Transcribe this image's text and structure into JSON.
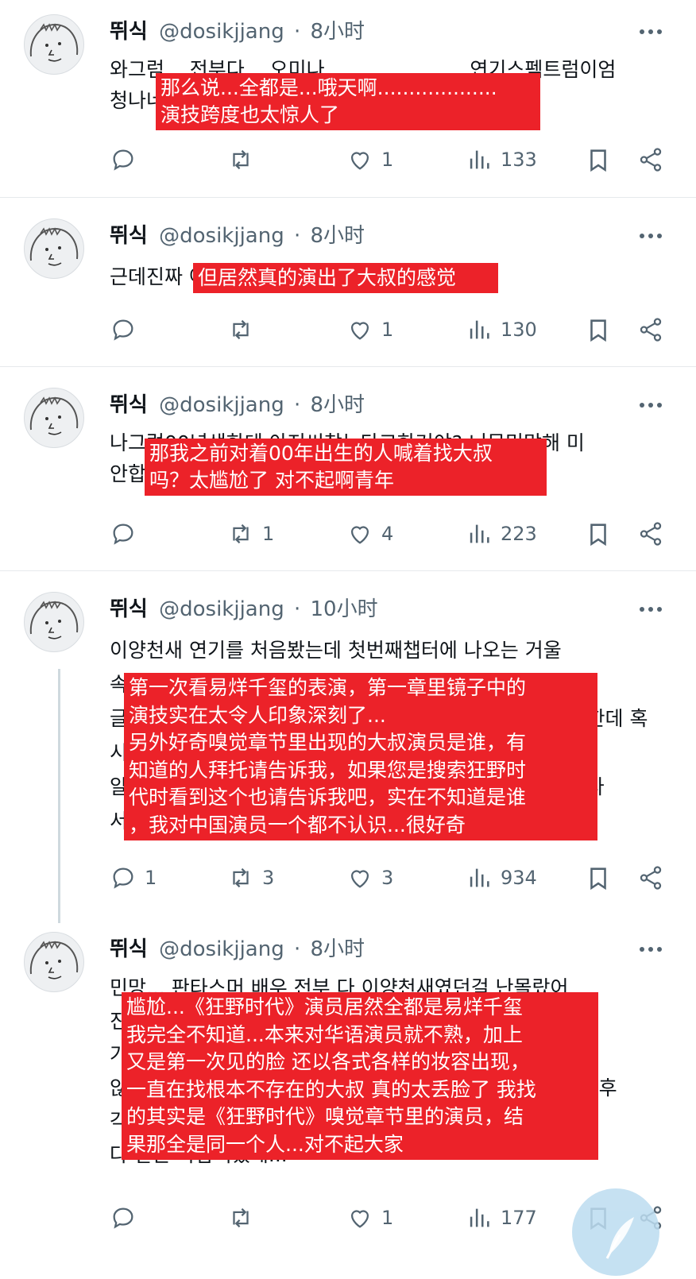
{
  "tweets": [
    {
      "name": "뛰식",
      "handle": "@dosikjjang",
      "time": "8小时",
      "text": "와그럼... 전부다... 오미나...................... 연기스펙트럼이엄\n청나네",
      "translation": "那么说...全都是...哦天啊...................\n演技跨度也太惊人了",
      "replies": "",
      "reposts": "",
      "likes": "1",
      "views": "133"
    },
    {
      "name": "뛰식",
      "handle": "@dosikjjang",
      "time": "8小时",
      "text": "근데진짜 아저씨 연기 잘한다 ㅋㅋ",
      "translation": "但居然真的演出了大叔的感觉",
      "replies": "",
      "reposts": "",
      "likes": "1",
      "views": "130"
    },
    {
      "name": "뛰식",
      "handle": "@dosikjjang",
      "time": "8小时",
      "text": "나그럼00년생한테 아저씨찾는다고한거야? 너무민망해 미\n안합니다 청년",
      "translation": "那我之前对着00年出生的人喊着找大叔\n吗？太尴尬了 对不起啊青年",
      "replies": "",
      "reposts": "1",
      "likes": "4",
      "views": "223"
    },
    {
      "name": "뛰식",
      "handle": "@dosikjjang",
      "time": "10小时",
      "text": "이양천새 연기를 처음봤는데 첫번째챕터에 나오는 거울\n속 연기가 너무인상깊어서\n글 쓴 거에요 그리고 후각 챕터의 아저씨 배우 뉘긴지 궁금한데 혹\n시 아시는 분 있나요? 광야시대 검색하다 보셔도\n알려주세요 진짜 누군지 모르겠어요 중국 배우를 하나도몰라\n서... 궁금해요",
      "translation": "第一次看易烊千玺的表演，第一章里镜子中的\n演技实在太令人印象深刻了...\n另外好奇嗅觉章节里出现的大叔演员是谁，有\n知道的人拜托请告诉我，如果您是搜索狂野时\n代时看到这个也请告诉我吧，实在不知道是谁\n，我对中国演员一个都不认识...很好奇",
      "replies": "1",
      "reposts": "3",
      "likes": "3",
      "views": "934"
    },
    {
      "name": "뛰식",
      "handle": "@dosikjjang",
      "time": "8小时",
      "text": "민망... 판타스머 배우 전부 다 이양천새였던걸 난몰랐어\n진짜 중화권 배우들 잘 모르는데 다 처음 보는 얼굴인데다\n가 분장을 각양각색으로 해서 나오니까 있지도 존재하지도\n않는 아저씨를 찾고있었던거야 진짜 민망하다 내가 찾던 건 후\n각 챕터의 배우였는데 결국\n다 같은 사람이었네...",
      "translation": "尴尬...《狂野时代》演员居然全都是易烊千玺\n我完全不知道...本来对华语演员就不熟，加上\n又是第一次见的脸 还以各式各样的妆容出现，\n一直在找根本不存在的大叔 真的太丢脸了 我找\n的其实是《狂野时代》嗅觉章节里的演员，结\n果那全是同一个人...对不起大家",
      "replies": "",
      "reposts": "",
      "likes": "1",
      "views": "177"
    }
  ],
  "icons": {
    "reply": "reply-icon",
    "repost": "repost-icon",
    "like": "heart-icon",
    "views": "views-icon",
    "bookmark": "bookmark-icon",
    "share": "share-icon",
    "more": "more-icon"
  },
  "colors": {
    "translation_bg": "#ec2229",
    "muted": "#536471",
    "text": "#0f1419"
  }
}
